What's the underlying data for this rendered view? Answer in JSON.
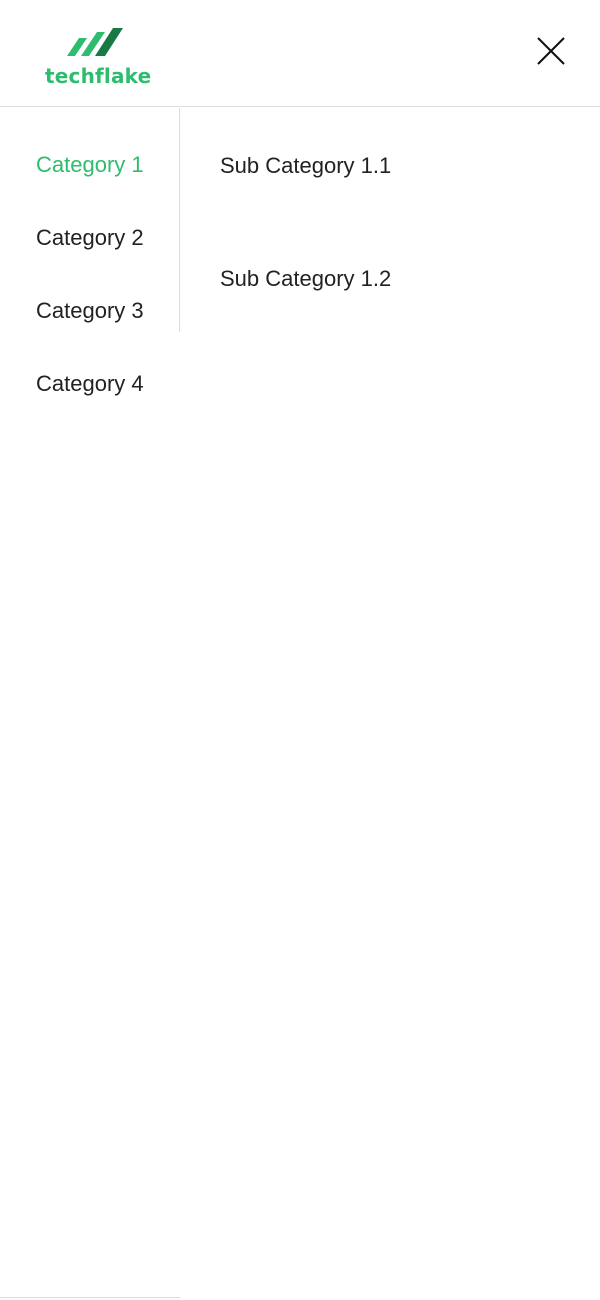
{
  "brand": {
    "name": "techflake",
    "color": "#2ebd6e",
    "color_dark": "#177a44",
    "logo_icon": "techflake-logo-icon"
  },
  "header": {
    "close_icon": "close-icon"
  },
  "categories": [
    {
      "label": "Category 1",
      "active": true
    },
    {
      "label": "Category 2",
      "active": false
    },
    {
      "label": "Category 3",
      "active": false
    },
    {
      "label": "Category 4",
      "active": false
    }
  ],
  "subcategories": [
    {
      "label": "Sub Category 1.1"
    },
    {
      "label": "Sub Category 1.2"
    }
  ],
  "colors": {
    "active": "#2ebd6e",
    "text": "#222222",
    "divider": "#dddddd",
    "background": "#ffffff"
  }
}
